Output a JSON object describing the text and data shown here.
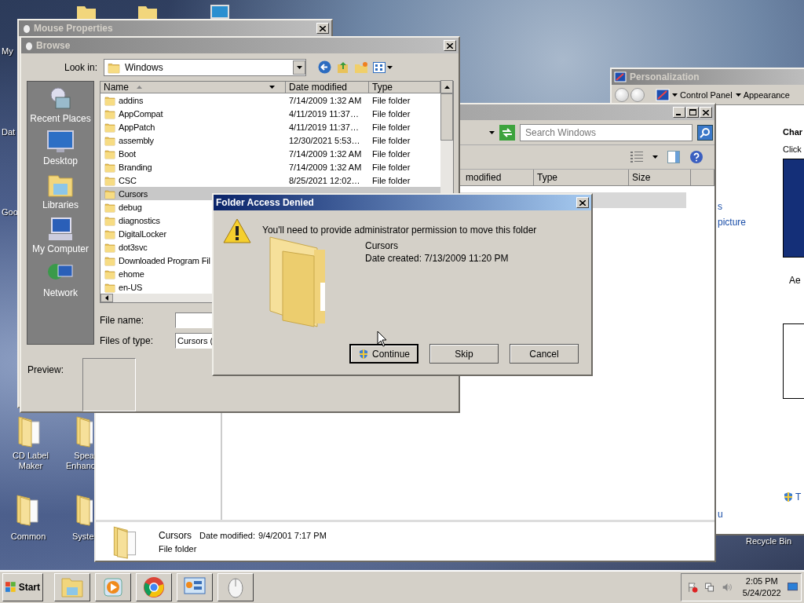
{
  "desktop_icons": [
    {
      "label": "My"
    },
    {
      "label": "Dat"
    },
    {
      "label": "Goo"
    },
    {
      "label": "CD Label Maker"
    },
    {
      "label": "Spea Enhanc"
    },
    {
      "label": "Common"
    },
    {
      "label": "Syste"
    },
    {
      "label": "Recycle Bin"
    }
  ],
  "personalization": {
    "title": "Personalization",
    "breadcrumb": [
      "Control Panel",
      "Appearance"
    ],
    "sidebar_links": [
      "s",
      "picture",
      "u"
    ],
    "heading": "Char",
    "intro": "Click",
    "theme_label": "Ae",
    "footer_link": "T"
  },
  "explorer": {
    "search": {
      "placeholder": "Search Windows"
    },
    "columns": [
      "modified",
      "Type",
      "Size"
    ],
    "details": {
      "name": "Cursors",
      "date_label": "Date modified:",
      "date": "9/4/2001 7:17 PM",
      "type": "File folder"
    }
  },
  "mouse_properties": {
    "title": "Mouse Properties"
  },
  "browse": {
    "title": "Browse",
    "look_in_label": "Look in:",
    "look_in": "Windows",
    "places": [
      {
        "label": "Recent Places",
        "kind": "recent"
      },
      {
        "label": "Desktop",
        "kind": "desktop"
      },
      {
        "label": "Libraries",
        "kind": "libraries"
      },
      {
        "label": "My Computer",
        "kind": "computer"
      },
      {
        "label": "Network",
        "kind": "network"
      }
    ],
    "columns": [
      "Name",
      "Date modified",
      "Type"
    ],
    "files": [
      {
        "name": "addins",
        "date": "7/14/2009 1:32 AM",
        "type": "File folder",
        "selected": false
      },
      {
        "name": "AppCompat",
        "date": "4/11/2019 11:37…",
        "type": "File folder",
        "selected": false
      },
      {
        "name": "AppPatch",
        "date": "4/11/2019 11:37…",
        "type": "File folder",
        "selected": false
      },
      {
        "name": "assembly",
        "date": "12/30/2021 5:53…",
        "type": "File folder",
        "selected": false
      },
      {
        "name": "Boot",
        "date": "7/14/2009 1:32 AM",
        "type": "File folder",
        "selected": false
      },
      {
        "name": "Branding",
        "date": "7/14/2009 1:32 AM",
        "type": "File folder",
        "selected": false
      },
      {
        "name": "CSC",
        "date": "8/25/2021 12:02…",
        "type": "File folder",
        "selected": false
      },
      {
        "name": "Cursors",
        "selected": true
      },
      {
        "name": "debug",
        "selected": false
      },
      {
        "name": "diagnostics",
        "selected": false
      },
      {
        "name": "DigitalLocker",
        "selected": false
      },
      {
        "name": "dot3svc",
        "selected": false
      },
      {
        "name": "Downloaded Program Fil",
        "selected": false
      },
      {
        "name": "ehome",
        "selected": false
      },
      {
        "name": "en-US",
        "selected": false
      }
    ],
    "file_name_label": "File name:",
    "file_type_label": "Files of type:",
    "file_type": "Cursors (",
    "preview_label": "Preview:"
  },
  "dialog": {
    "title": "Folder Access Denied",
    "message": "You'll need to provide administrator permission to move this folder",
    "item_name": "Cursors",
    "item_date": "Date created: 7/13/2009 11:20 PM",
    "buttons": [
      {
        "label": "Continue",
        "kind": "elevated",
        "default": true
      },
      {
        "label": "Skip",
        "kind": "plain",
        "default": false
      },
      {
        "label": "Cancel",
        "kind": "plain",
        "default": false
      }
    ]
  },
  "taskbar": {
    "start": "Start",
    "time": "2:05 PM",
    "date": "5/24/2022"
  }
}
